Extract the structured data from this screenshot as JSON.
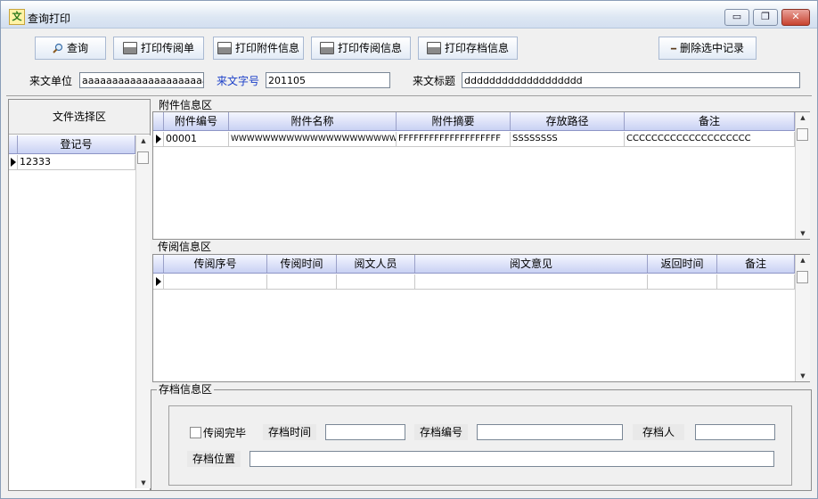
{
  "window": {
    "title": "查询打印",
    "app_icon_glyph": "文",
    "min_glyph": "▭",
    "restore_glyph": "❐",
    "close_glyph": "✕"
  },
  "toolbar": {
    "query_label": "查询",
    "print_circulation_label": "打印传阅单",
    "print_attachment_label": "打印附件信息",
    "print_circulation_info_label": "打印传阅信息",
    "print_archive_label": "打印存档信息",
    "delete_label": "删除选中记录",
    "delete_glyph": "━"
  },
  "filters": {
    "unit_label": "来文单位",
    "unit_value": "aaaaaaaaaaaaaaaaaaaaaaaaaa",
    "number_label": "来文字号",
    "number_value": "201105",
    "title_label": "来文标题",
    "title_value": "ddddddddddddddddddd"
  },
  "left_panel": {
    "title": "文件选择区",
    "column": "登记号",
    "rows": [
      "12333"
    ]
  },
  "attachments": {
    "title": "附件信息区",
    "columns": [
      "附件编号",
      "附件名称",
      "附件摘要",
      "存放路径",
      "备注"
    ],
    "rows": [
      [
        "00001",
        "WWWWWWWWWWWWWWWWWWWWWWW",
        "FFFFFFFFFFFFFFFFFFFF",
        "SSSSSSSS",
        "CCCCCCCCCCCCCCCCCCCC"
      ]
    ]
  },
  "circulation": {
    "title": "传阅信息区",
    "columns": [
      "传阅序号",
      "传阅时间",
      "阅文人员",
      "阅文意见",
      "返回时间",
      "备注"
    ]
  },
  "archive": {
    "title": "存档信息区",
    "read_done_label": "传阅完毕",
    "time_label": "存档时间",
    "number_label": "存档编号",
    "person_label": "存档人",
    "location_label": "存档位置"
  },
  "colors": {
    "accent_blue": "#1a3ec8",
    "grid_header": "#c9d1f3"
  }
}
